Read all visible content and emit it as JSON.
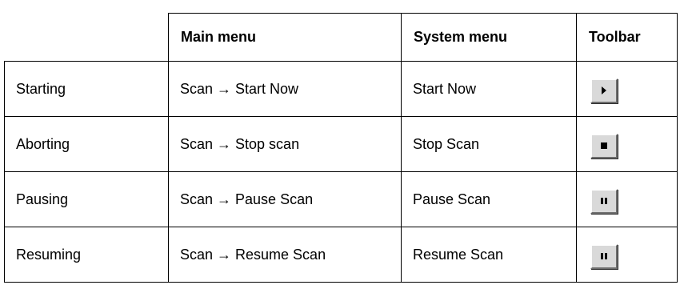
{
  "table": {
    "headers": {
      "action": "",
      "main_menu": "Main menu",
      "system_menu": "System menu",
      "toolbar": "Toolbar"
    },
    "rows": [
      {
        "action": "Starting",
        "main_menu": "Scan → Start Now",
        "system_menu": "Start Now",
        "toolbar_icon": "play-icon"
      },
      {
        "action": "Aborting",
        "main_menu": "Scan → Stop scan",
        "system_menu": "Stop Scan",
        "toolbar_icon": "stop-icon"
      },
      {
        "action": "Pausing",
        "main_menu": "Scan → Pause Scan",
        "system_menu": "Pause Scan",
        "toolbar_icon": "pause-icon"
      },
      {
        "action": "Resuming",
        "main_menu": "Scan → Resume Scan",
        "system_menu": "Resume Scan",
        "toolbar_icon": "pause-icon"
      }
    ]
  },
  "colors": {
    "button_face": "#d9d9d9",
    "border": "#000000"
  }
}
